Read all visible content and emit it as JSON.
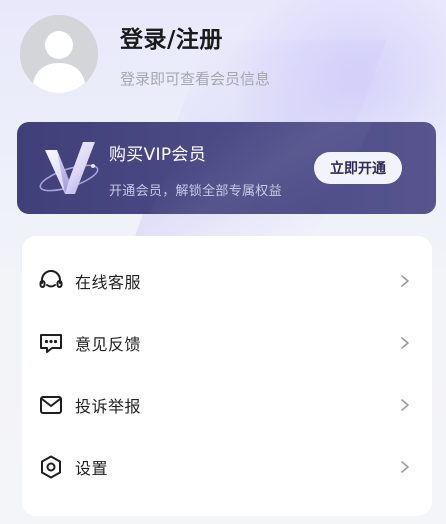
{
  "profile": {
    "title": "登录/注册",
    "subtitle": "登录即可查看会员信息",
    "avatar_icon": "default-user-avatar-icon"
  },
  "vip": {
    "title": "购买VIP会员",
    "subtitle": "开通会员，解锁全部专属权益",
    "button_label": "立即开通",
    "logo_icon": "vip-v-logo-icon",
    "card_color": "#4b4a85"
  },
  "menu": {
    "items": [
      {
        "label": "在线客服",
        "icon": "headset-icon"
      },
      {
        "label": "意见反馈",
        "icon": "feedback-chat-icon"
      },
      {
        "label": "投诉举报",
        "icon": "mail-icon"
      },
      {
        "label": "设置",
        "icon": "settings-hexagon-icon"
      }
    ]
  },
  "colors": {
    "text_primary": "#1a1a1a",
    "text_secondary": "#a7a7b0",
    "chevron": "#9a9aa2"
  }
}
